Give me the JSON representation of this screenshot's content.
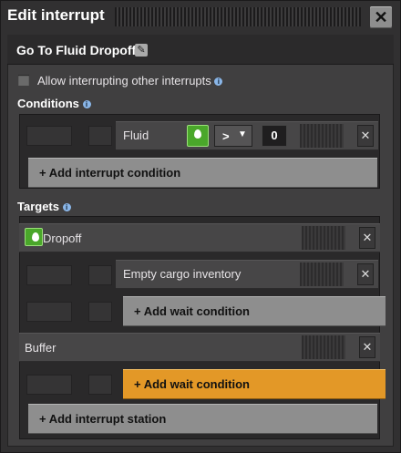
{
  "window": {
    "title": "Edit interrupt",
    "close_symbol": "✕"
  },
  "interrupt": {
    "name": "Go To Fluid Dropoff",
    "edit_icon": "pencil-icon"
  },
  "allow_interrupting": {
    "label": "Allow interrupting other interrupts",
    "checked": false
  },
  "conditions": {
    "heading": "Conditions",
    "items": [
      {
        "label": "Fluid",
        "signal_icon": "fluid-drop-icon",
        "comparator": ">",
        "value": "0"
      }
    ],
    "add_label": "+ Add interrupt condition"
  },
  "targets": {
    "heading": "Targets",
    "stations": [
      {
        "name": "Dropoff",
        "icon": "fluid-drop-icon",
        "wait_conditions": [
          "Empty cargo inventory"
        ],
        "add_wait_label": "+ Add wait condition"
      },
      {
        "name": "Buffer",
        "wait_conditions": [],
        "add_wait_label": "+ Add wait condition"
      }
    ],
    "add_station_label": "+ Add interrupt station"
  },
  "colors": {
    "accent_orange": "#e39827",
    "signal_green": "#4aa72a"
  }
}
